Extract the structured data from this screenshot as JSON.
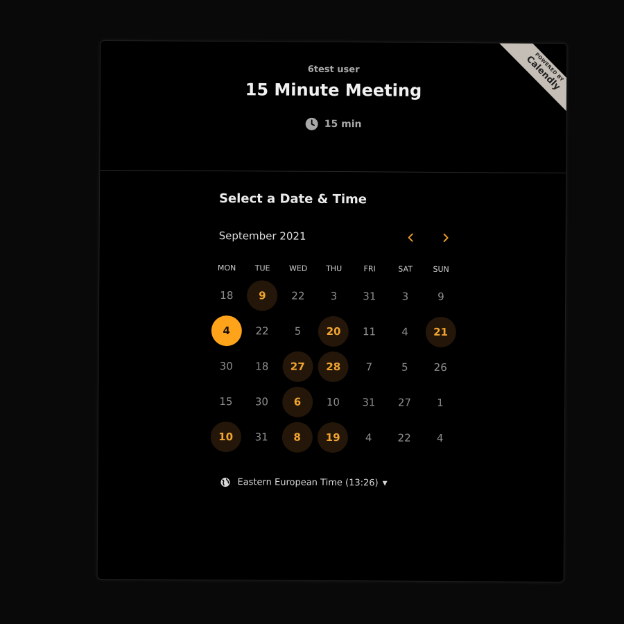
{
  "header": {
    "host": "6test user",
    "title": "15 Minute Meeting",
    "duration": "15 min"
  },
  "ribbon": {
    "small": "POWERED BY",
    "brand": "Calendly"
  },
  "picker": {
    "heading": "Select a Date & Time",
    "month": "September 2021",
    "prev_icon": "chevron-left-icon",
    "next_icon": "chevron-right-icon",
    "weekdays": [
      "MON",
      "TUE",
      "WED",
      "THU",
      "FRI",
      "SAT",
      "SUN"
    ],
    "days": [
      {
        "label": "18",
        "state": "unavailable"
      },
      {
        "label": "9",
        "state": "available"
      },
      {
        "label": "22",
        "state": "unavailable"
      },
      {
        "label": "3",
        "state": "unavailable"
      },
      {
        "label": "31",
        "state": "unavailable"
      },
      {
        "label": "3",
        "state": "unavailable"
      },
      {
        "label": "9",
        "state": "unavailable"
      },
      {
        "label": "4",
        "state": "selected"
      },
      {
        "label": "22",
        "state": "unavailable"
      },
      {
        "label": "5",
        "state": "unavailable"
      },
      {
        "label": "20",
        "state": "available"
      },
      {
        "label": "11",
        "state": "unavailable"
      },
      {
        "label": "4",
        "state": "unavailable"
      },
      {
        "label": "21",
        "state": "available"
      },
      {
        "label": "30",
        "state": "unavailable"
      },
      {
        "label": "18",
        "state": "unavailable"
      },
      {
        "label": "27",
        "state": "available"
      },
      {
        "label": "28",
        "state": "available"
      },
      {
        "label": "7",
        "state": "unavailable"
      },
      {
        "label": "5",
        "state": "unavailable"
      },
      {
        "label": "26",
        "state": "unavailable"
      },
      {
        "label": "15",
        "state": "unavailable"
      },
      {
        "label": "30",
        "state": "unavailable"
      },
      {
        "label": "6",
        "state": "available"
      },
      {
        "label": "10",
        "state": "unavailable"
      },
      {
        "label": "31",
        "state": "unavailable"
      },
      {
        "label": "27",
        "state": "unavailable"
      },
      {
        "label": "1",
        "state": "unavailable"
      },
      {
        "label": "10",
        "state": "available"
      },
      {
        "label": "31",
        "state": "unavailable"
      },
      {
        "label": "8",
        "state": "available"
      },
      {
        "label": "19",
        "state": "available"
      },
      {
        "label": "4",
        "state": "unavailable"
      },
      {
        "label": "22",
        "state": "unavailable"
      },
      {
        "label": "4",
        "state": "unavailable"
      }
    ]
  },
  "timezone": {
    "label": "Eastern European Time (13:26)",
    "icon": "globe-icon"
  },
  "colors": {
    "accent": "#ffa31a",
    "available_bg": "#241709",
    "available_text": "#f2a531"
  }
}
